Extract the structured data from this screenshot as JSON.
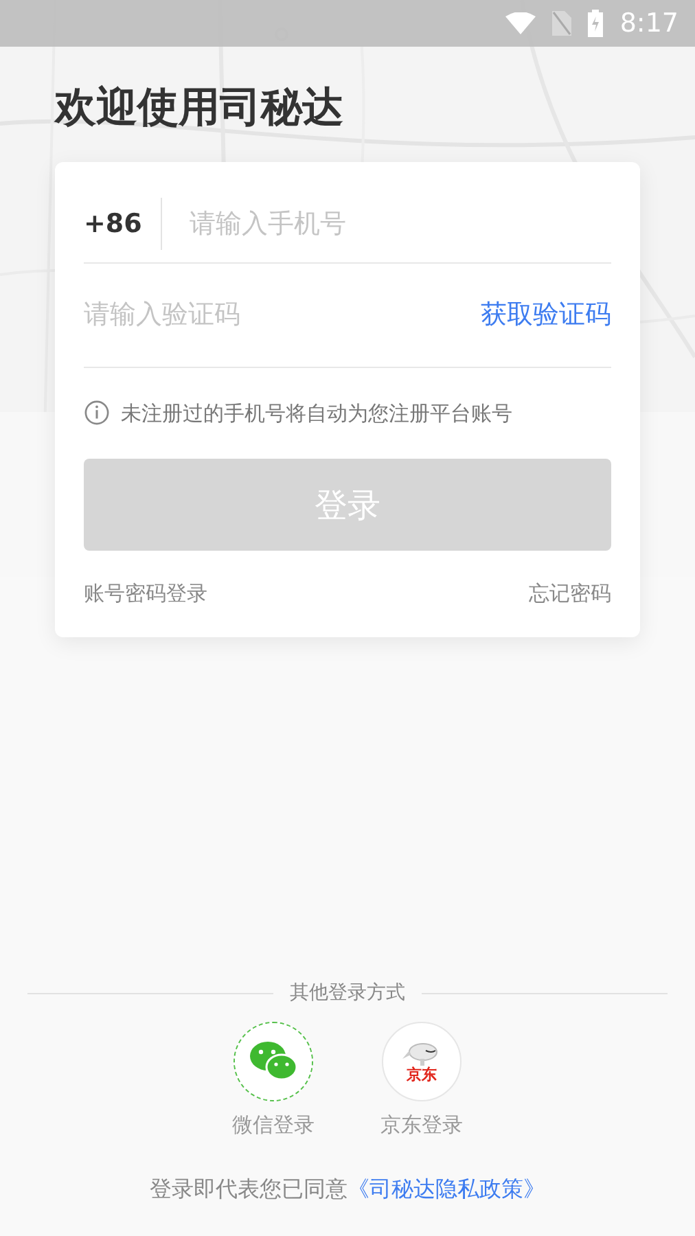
{
  "status_bar": {
    "time": "8:17"
  },
  "title": "欢迎使用司秘达",
  "login_form": {
    "country_code": "+86",
    "phone": {
      "placeholder": "请输入手机号"
    },
    "code": {
      "placeholder": "请输入验证码"
    },
    "get_code": "获取验证码",
    "notice": "未注册过的手机号将自动为您注册平台账号",
    "login_button": {
      "label": "登录",
      "disabled": true
    },
    "password_login": "账号密码登录",
    "forgot_password": "忘记密码"
  },
  "other_login": {
    "heading": "其他登录方式",
    "options": [
      {
        "kind": "wechat",
        "label": "微信登录"
      },
      {
        "kind": "jd",
        "label": "京东登录",
        "logo_text": "京东"
      }
    ]
  },
  "agreement": {
    "text": "登录即代表您已同意",
    "link": "《司秘达隐私政策》"
  }
}
